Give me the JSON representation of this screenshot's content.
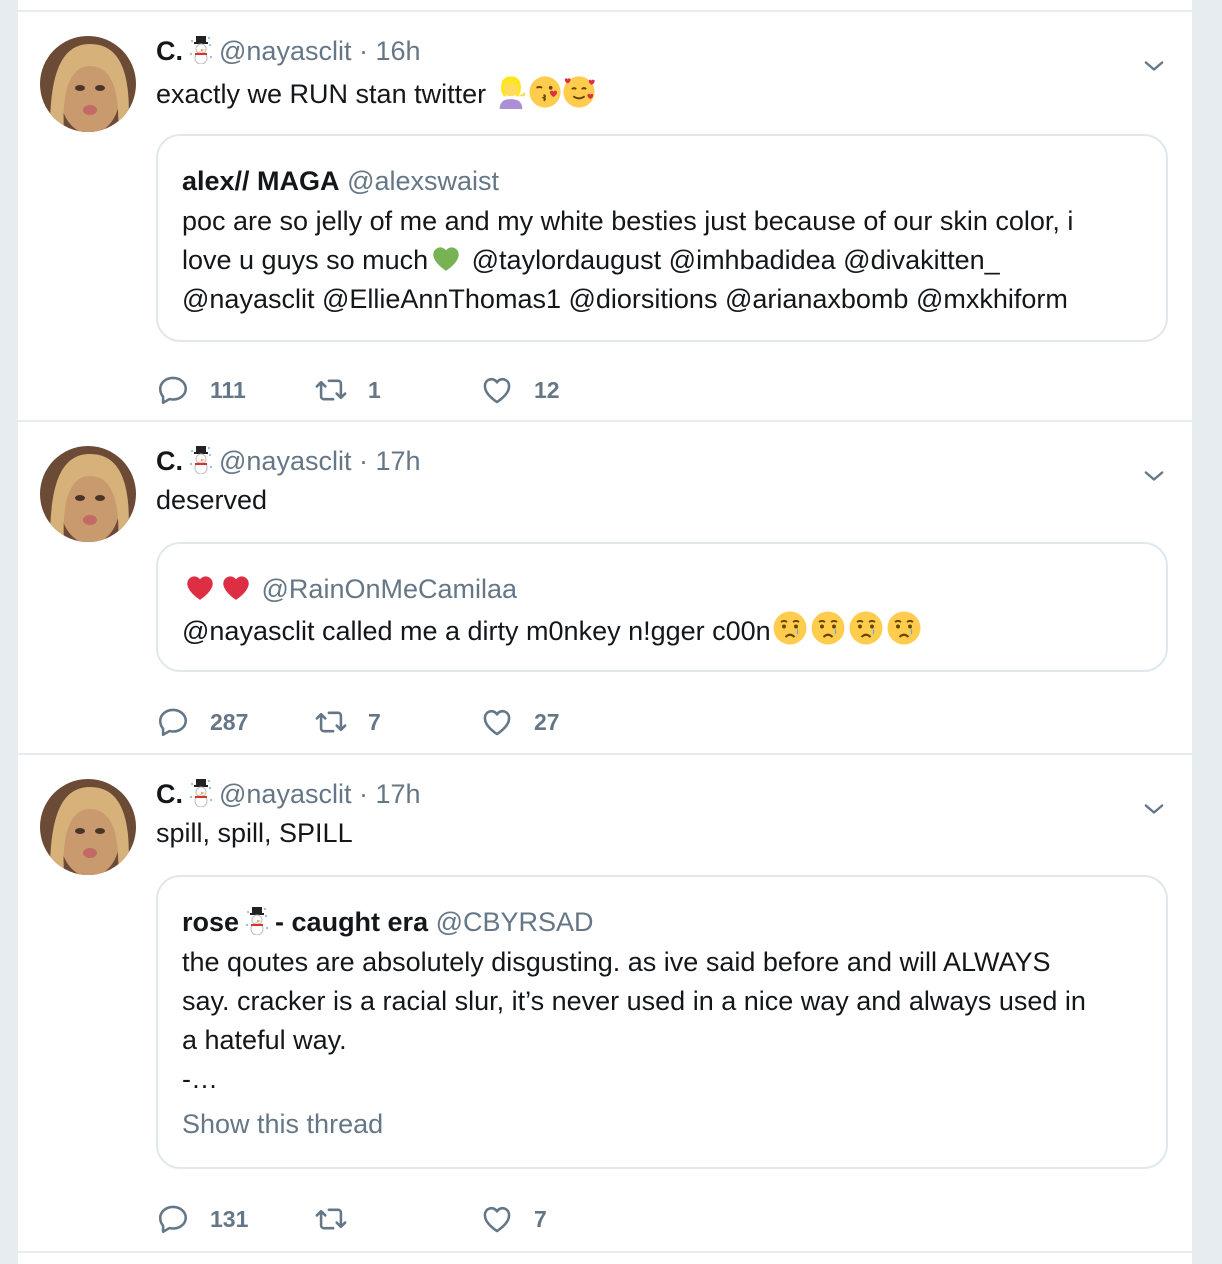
{
  "tweets": [
    {
      "author_name": "C.",
      "author_handle": "@nayasclit",
      "dot": "·",
      "time": "16h",
      "text": "exactly we RUN stan twitter",
      "quote": {
        "name": "alex// MAGA",
        "handle": "@alexswaist",
        "line1": "poc are so jelly of me and my white besties just because of our skin color, i",
        "line2a": "love u guys so much",
        "line2b": "@taylordaugust @imhbadidea @divakitten_",
        "line3": "@nayasclit @EllieAnnThomas1 @diorsitions @arianaxbomb @mxkhiform"
      },
      "replies": "111",
      "retweets": "1",
      "likes": "12"
    },
    {
      "author_name": "C.",
      "author_handle": "@nayasclit",
      "dot": "·",
      "time": "17h",
      "text": "deserved",
      "quote": {
        "handle": "@RainOnMeCamilaa",
        "line1": "@nayasclit called me a dirty m0nkey n!gger c00n"
      },
      "replies": "287",
      "retweets": "7",
      "likes": "27"
    },
    {
      "author_name": "C.",
      "author_handle": "@nayasclit",
      "dot": "·",
      "time": "17h",
      "text": "spill, spill, SPILL",
      "quote": {
        "name_a": "rose",
        "name_b": "- caught era",
        "handle": "@CBYRSAD",
        "line1": "the qoutes are absolutely disgusting. as ive said before and will ALWAYS",
        "line2": "say. cracker is a racial slur, it’s never used in a nice way and always used in",
        "line3": "a hateful way.",
        "line4": "-…",
        "link": "Show this thread"
      },
      "replies": "131",
      "retweets": "",
      "likes": "7"
    }
  ],
  "icons": {
    "reply": "reply-icon",
    "retweet": "retweet-icon",
    "like": "heart-icon",
    "caret": "chevron-down-icon",
    "badge": "snowman-icon"
  },
  "colors": {
    "background": "#e6ecf0",
    "secondary_text": "#657786",
    "border": "#e1e8ed"
  }
}
